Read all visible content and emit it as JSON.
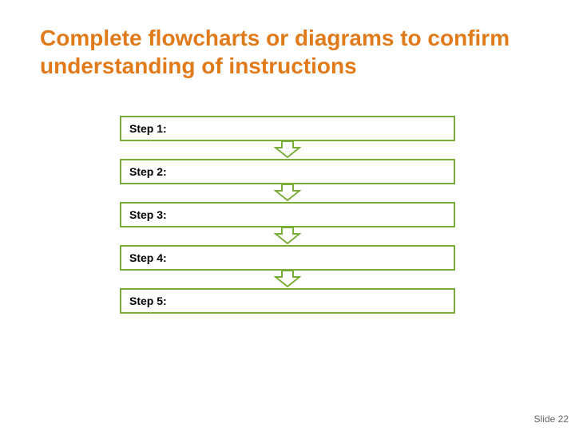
{
  "title": "Complete flowcharts or diagrams to confirm understanding of instructions",
  "steps": [
    {
      "label": "Step 1:"
    },
    {
      "label": "Step 2:"
    },
    {
      "label": "Step 3:"
    },
    {
      "label": "Step 4:"
    },
    {
      "label": "Step 5:"
    }
  ],
  "footer": {
    "slide_label": "Slide 22"
  },
  "colors": {
    "title": "#e17a1a",
    "box_border": "#7aad3a",
    "arrow_stroke": "#7aad3a",
    "arrow_fill": "#ffffff"
  }
}
